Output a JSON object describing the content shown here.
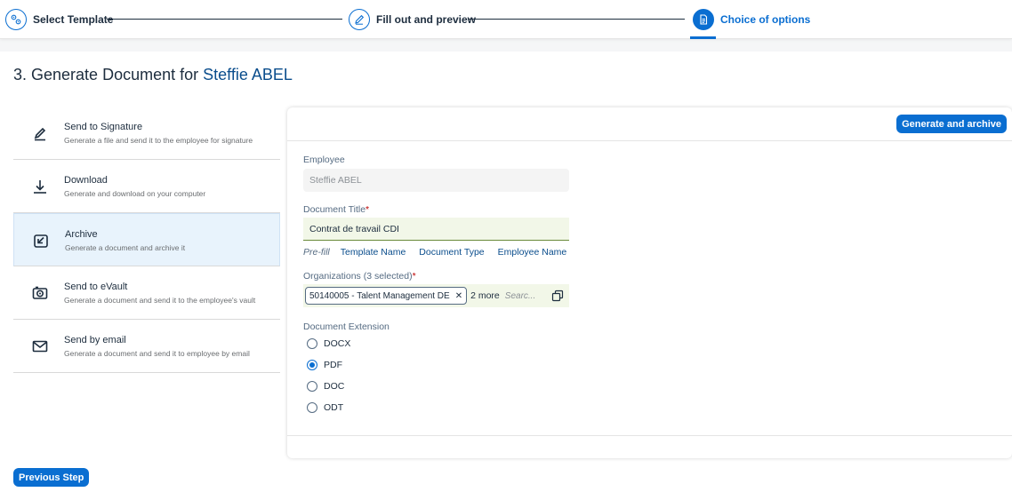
{
  "wizard": {
    "steps": [
      {
        "label": "Select Template",
        "icon": "template-gears-icon"
      },
      {
        "label": "Fill out and preview",
        "icon": "edit-pen-icon"
      },
      {
        "label": "Choice of options",
        "icon": "document-icon"
      }
    ]
  },
  "header": {
    "title_prefix": "3. Generate Document for",
    "employee_name": "Steffie ABEL"
  },
  "options": [
    {
      "title": "Send to Signature",
      "desc": "Generate a file and send it to the employee for signature",
      "icon": "signature-icon"
    },
    {
      "title": "Download",
      "desc": "Generate and download on your computer",
      "icon": "download-icon"
    },
    {
      "title": "Archive",
      "desc": "Generate a document and archive it",
      "icon": "archive-icon"
    },
    {
      "title": "Send to eVault",
      "desc": "Generate a document and send it to the employee's vault",
      "icon": "vault-icon"
    },
    {
      "title": "Send by email",
      "desc": "Generate a document and send it to employee by email",
      "icon": "email-icon"
    }
  ],
  "form": {
    "generate_label": "Generate and archive",
    "employee_label": "Employee",
    "employee_value": "Steffie ABEL",
    "doc_title_label": "Document Title",
    "doc_title_value": "Contrat de travail CDI",
    "prefill_label": "Pre-fill",
    "prefill_links": [
      "Template Name",
      "Document Type",
      "Employee Name"
    ],
    "orgs_label": "Organizations (3 selected)",
    "org_token": "50140005 - Talent Management DE",
    "org_more": "2 more",
    "org_search_placeholder": "Searc...",
    "extension_label": "Document Extension",
    "extensions": [
      "DOCX",
      "PDF",
      "DOC",
      "ODT"
    ],
    "selected_extension": "PDF"
  },
  "footer": {
    "previous_label": "Previous Step"
  },
  "colors": {
    "accent": "#0a6ed1",
    "selected_bg": "#e8f3fc",
    "required": "#bb0000"
  }
}
